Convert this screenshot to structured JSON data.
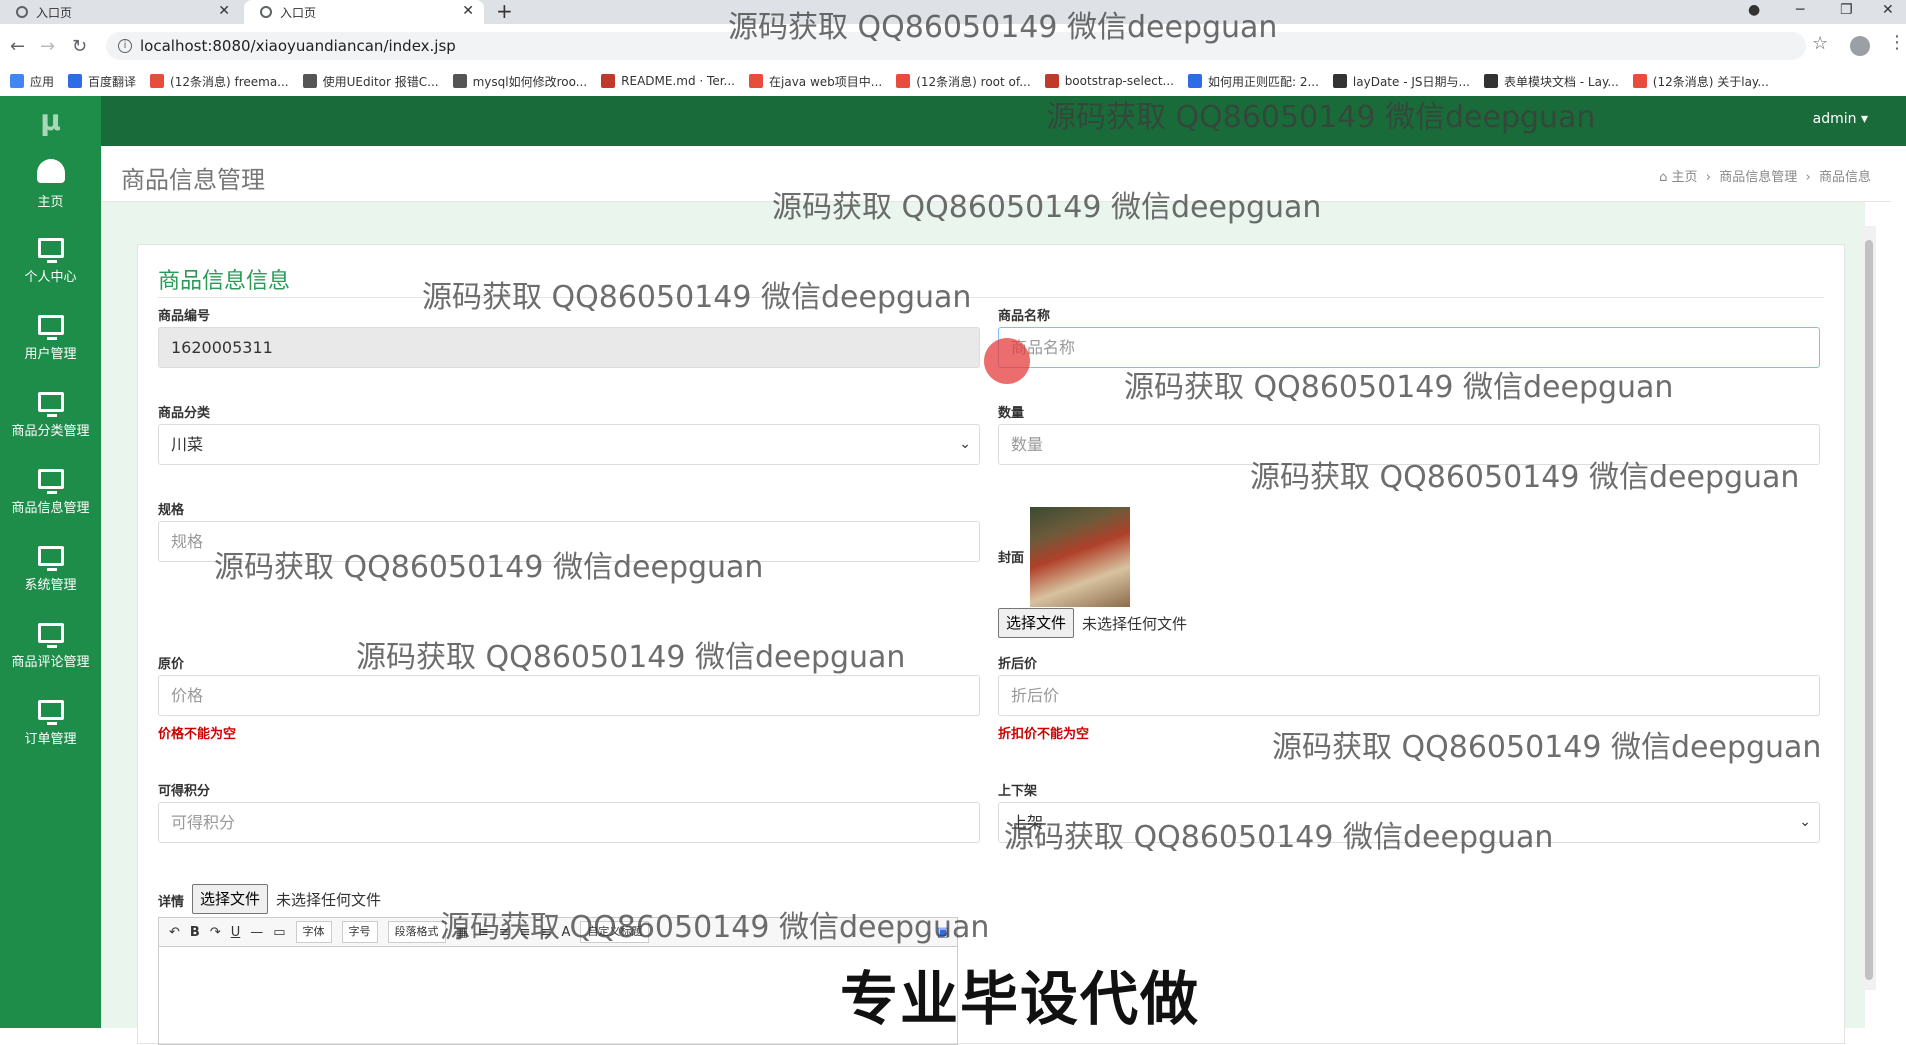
{
  "browser": {
    "tabs": [
      {
        "label": "入口页",
        "active": false
      },
      {
        "label": "入口页",
        "active": true
      }
    ],
    "new_tab": "+",
    "url": "localhost:8080/xiaoyuandiancan/index.jsp",
    "bookmarks": [
      {
        "label": "应用",
        "color": "#4285f4"
      },
      {
        "label": "百度翻译",
        "color": "#2e6be6"
      },
      {
        "label": "(12条消息) freema...",
        "color": "#e74c3c"
      },
      {
        "label": "使用UEditor 报错C...",
        "color": "#555555"
      },
      {
        "label": "mysql如何修改roo...",
        "color": "#555555"
      },
      {
        "label": "README.md · Ter...",
        "color": "#c0392b"
      },
      {
        "label": "在java web项目中...",
        "color": "#e74c3c"
      },
      {
        "label": "(12条消息) root of...",
        "color": "#e74c3c"
      },
      {
        "label": "bootstrap-select...",
        "color": "#c0392b"
      },
      {
        "label": "如何用正则匹配: 2...",
        "color": "#2e6be6"
      },
      {
        "label": "layDate - JS日期与...",
        "color": "#333333"
      },
      {
        "label": "表单模块文档 - Lay...",
        "color": "#333333"
      },
      {
        "label": "(12条消息) 关于lay...",
        "color": "#e74c3c"
      }
    ]
  },
  "app": {
    "logo": "μ",
    "user": "admin ▾",
    "sidebar": [
      {
        "label": "主页",
        "icon": "dashboard-icon"
      },
      {
        "label": "个人中心",
        "icon": "monitor-icon"
      },
      {
        "label": "用户管理",
        "icon": "monitor-icon"
      },
      {
        "label": "商品分类管理",
        "icon": "monitor-icon"
      },
      {
        "label": "商品信息管理",
        "icon": "monitor-icon"
      },
      {
        "label": "系统管理",
        "icon": "monitor-icon"
      },
      {
        "label": "商品评论管理",
        "icon": "monitor-icon"
      },
      {
        "label": "订单管理",
        "icon": "monitor-icon"
      }
    ],
    "page_title": "商品信息管理",
    "breadcrumb": {
      "home": "主页",
      "sep": "›",
      "level1": "商品信息管理",
      "level2": "商品信息"
    },
    "card_title": "商品信息信息"
  },
  "form": {
    "code": {
      "label": "商品编号",
      "value": "1620005311"
    },
    "name": {
      "label": "商品名称",
      "placeholder": "商品名称"
    },
    "category": {
      "label": "商品分类",
      "value": "川菜"
    },
    "quantity": {
      "label": "数量",
      "placeholder": "数量"
    },
    "spec": {
      "label": "规格",
      "placeholder": "规格"
    },
    "cover": {
      "label": "封面",
      "button": "选择文件",
      "file_text": "未选择任何文件"
    },
    "price": {
      "label": "原价",
      "placeholder": "价格",
      "error": "价格不能为空"
    },
    "discount": {
      "label": "折后价",
      "placeholder": "折后价",
      "error": "折扣价不能为空"
    },
    "points": {
      "label": "可得积分",
      "placeholder": "可得积分"
    },
    "shelf": {
      "label": "上下架",
      "value": "上架"
    },
    "detail": {
      "label": "详情",
      "button": "选择文件",
      "file_text": "未选择任何文件"
    },
    "editor": {
      "font": "字体",
      "size": "字号",
      "para": "段落格式",
      "custom": "自定义标题",
      "bold": "B",
      "underline": "U",
      "fontcolor": "A"
    }
  },
  "overlay": {
    "watermark": "源码获取 QQ86050149 微信deepguan",
    "caption": "专业毕设代做"
  }
}
